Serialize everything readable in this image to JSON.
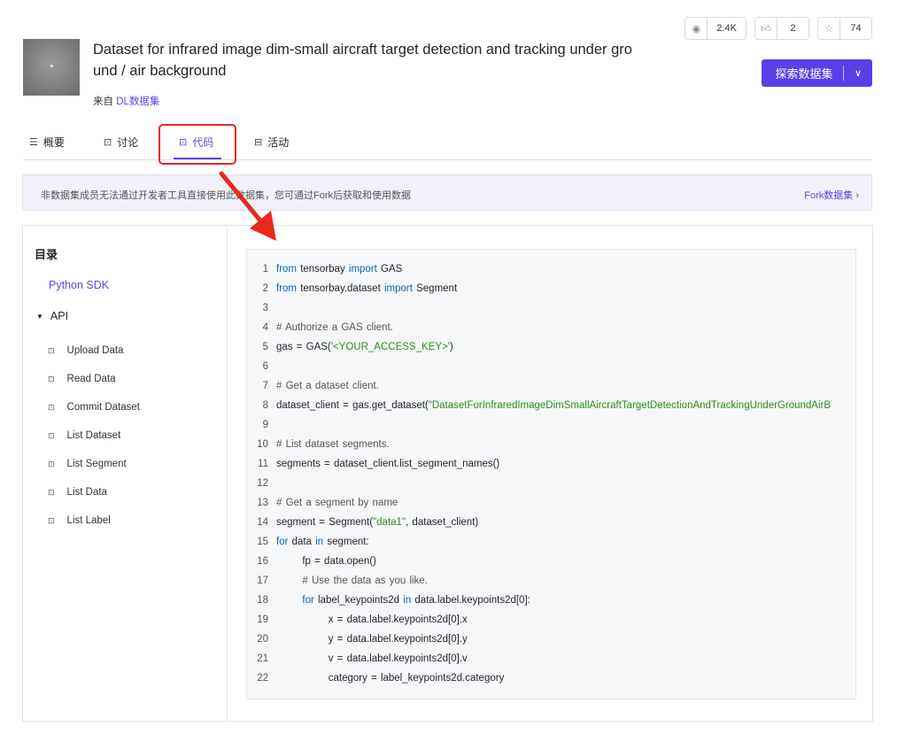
{
  "stats": [
    {
      "icon": "eye-icon",
      "glyph": "◉",
      "value": "2.4K"
    },
    {
      "icon": "thumbs-up-icon",
      "glyph": "👍︎",
      "value": "2"
    },
    {
      "icon": "star-icon",
      "glyph": "☆",
      "value": "74"
    }
  ],
  "dataset": {
    "title": "Dataset for infrared image dim-small aircraft target detection and tracking under gro und / air background",
    "source_prefix": "来自",
    "source_link": "DL数据集"
  },
  "explore_button": {
    "label": "探索数据集",
    "chevron": "∨"
  },
  "tabs": [
    {
      "label": "概要",
      "icon": "outline-icon",
      "glyph": "☰"
    },
    {
      "label": "讨论",
      "icon": "comment-icon",
      "glyph": "⊡"
    },
    {
      "label": "代码",
      "icon": "terminal-icon",
      "glyph": "⊡"
    },
    {
      "label": "活动",
      "icon": "calendar-icon",
      "glyph": "⊟"
    }
  ],
  "notice": {
    "text": "非数据集成员无法通过开发者工具直接使用此数据集，您可通过Fork后获取和使用数据",
    "link": "Fork数据集 ›"
  },
  "sidebar": {
    "title": "目录",
    "sdk": "Python SDK",
    "api_label": "API",
    "api_toggle": "▼",
    "api_items": [
      "Upload Data",
      "Read Data",
      "Commit Dataset",
      "List Dataset",
      "List Segment",
      "List Data",
      "List Label"
    ]
  },
  "code": {
    "lines": [
      {
        "n": "1",
        "html": "<span class=\"kw\">from</span> tensorbay <span class=\"kw\">import</span> GAS"
      },
      {
        "n": "2",
        "html": "<span class=\"kw\">from</span> tensorbay.dataset <span class=\"kw\">import</span> Segment"
      },
      {
        "n": "3",
        "html": ""
      },
      {
        "n": "4",
        "html": "<span class=\"cm\"># Authorize a GAS client.</span>"
      },
      {
        "n": "5",
        "html": "gas = GAS(<span class=\"str\">'&lt;YOUR_ACCESS_KEY&gt;'</span>)"
      },
      {
        "n": "6",
        "html": ""
      },
      {
        "n": "7",
        "html": "<span class=\"cm\"># Get a dataset client.</span>"
      },
      {
        "n": "8",
        "html": "dataset_client = gas.get_dataset(<span class=\"str\">\"DatasetForInfraredImageDimSmallAircraftTargetDetectionAndTrackingUnderGroundAirB</span>"
      },
      {
        "n": "9",
        "html": ""
      },
      {
        "n": "10",
        "html": "<span class=\"cm\"># List dataset segments.</span>"
      },
      {
        "n": "11",
        "html": "segments = dataset_client.list_segment_names()"
      },
      {
        "n": "12",
        "html": ""
      },
      {
        "n": "13",
        "html": "<span class=\"cm\"># Get a segment by name</span>"
      },
      {
        "n": "14",
        "html": "segment = Segment(<span class=\"str\">\"data1\"</span>, dataset_client)"
      },
      {
        "n": "15",
        "html": "<span class=\"kw\">for</span> data <span class=\"kw\">in</span> segment:"
      },
      {
        "n": "16",
        "html": "&nbsp;&nbsp;&nbsp;&nbsp;&nbsp;&nbsp;&nbsp;fp = data.open()"
      },
      {
        "n": "17",
        "html": "&nbsp;&nbsp;&nbsp;&nbsp;&nbsp;&nbsp;&nbsp;<span class=\"cm\"># Use the data as you like.</span>"
      },
      {
        "n": "18",
        "html": "&nbsp;&nbsp;&nbsp;&nbsp;&nbsp;&nbsp;&nbsp;<span class=\"kw\">for</span> label_keypoints2d <span class=\"kw\">in</span> data.label.keypoints2d[0]:"
      },
      {
        "n": "19",
        "html": "&nbsp;&nbsp;&nbsp;&nbsp;&nbsp;&nbsp;&nbsp;&nbsp;&nbsp;&nbsp;&nbsp;&nbsp;&nbsp;&nbsp;x = data.label.keypoints2d[0].x"
      },
      {
        "n": "20",
        "html": "&nbsp;&nbsp;&nbsp;&nbsp;&nbsp;&nbsp;&nbsp;&nbsp;&nbsp;&nbsp;&nbsp;&nbsp;&nbsp;&nbsp;y = data.label.keypoints2d[0].y"
      },
      {
        "n": "21",
        "html": "&nbsp;&nbsp;&nbsp;&nbsp;&nbsp;&nbsp;&nbsp;&nbsp;&nbsp;&nbsp;&nbsp;&nbsp;&nbsp;&nbsp;v = data.label.keypoints2d[0].v"
      },
      {
        "n": "22",
        "html": "&nbsp;&nbsp;&nbsp;&nbsp;&nbsp;&nbsp;&nbsp;&nbsp;&nbsp;&nbsp;&nbsp;&nbsp;&nbsp;&nbsp;category = label_keypoints2d.category"
      }
    ]
  },
  "colors": {
    "accent": "#5b47e6",
    "highlight": "#e8291c"
  }
}
